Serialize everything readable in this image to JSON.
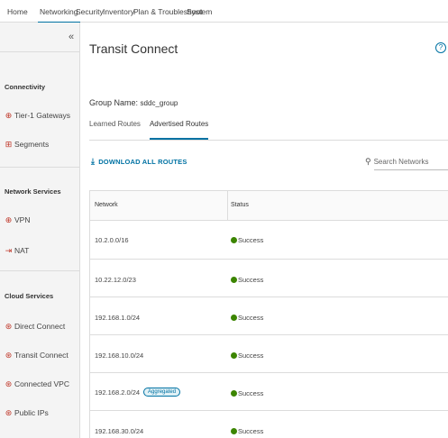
{
  "topnav": {
    "tabs": [
      {
        "label": "Home"
      },
      {
        "label": "Networking"
      },
      {
        "label": "Security"
      },
      {
        "label": "Inventory"
      },
      {
        "label": "Plan & Troubleshoot"
      },
      {
        "label": "System"
      }
    ],
    "active_tab": "Networking"
  },
  "sidebar": {
    "collapse_glyph": "«",
    "sections": [
      {
        "title": "Connectivity",
        "items": [
          {
            "label": "Tier-1 Gateways"
          },
          {
            "label": "Segments"
          }
        ]
      },
      {
        "title": "Network Services",
        "items": [
          {
            "label": "VPN"
          },
          {
            "label": "NAT"
          }
        ]
      },
      {
        "title": "Cloud Services",
        "items": [
          {
            "label": "Direct Connect"
          },
          {
            "label": "Transit Connect"
          },
          {
            "label": "Connected VPC"
          },
          {
            "label": "Public IPs"
          }
        ]
      }
    ]
  },
  "main": {
    "title": "Transit Connect",
    "help_glyph": "?",
    "group_label": "Group Name:",
    "group_value": "sddc_group",
    "subtabs": [
      {
        "label": "Learned Routes"
      },
      {
        "label": "Advertised Routes"
      }
    ],
    "active_subtab": "Advertised Routes",
    "download_label": "DOWNLOAD ALL ROUTES",
    "search_placeholder": "Search Networks",
    "table": {
      "columns": [
        "Network",
        "Status"
      ],
      "rows": [
        {
          "network": "10.2.0.0/16",
          "badge": "",
          "status": "Success"
        },
        {
          "network": "10.22.12.0/23",
          "badge": "",
          "status": "Success"
        },
        {
          "network": "192.168.1.0/24",
          "badge": "",
          "status": "Success"
        },
        {
          "network": "192.168.10.0/24",
          "badge": "",
          "status": "Success"
        },
        {
          "network": "192.168.2.0/24",
          "badge": "Aggregated",
          "status": "Success"
        },
        {
          "network": "192.168.30.0/24",
          "badge": "",
          "status": "Success"
        }
      ]
    }
  },
  "colors": {
    "accent": "#0072a3",
    "success": "#3c8500",
    "icon_red": "#c0392b"
  }
}
